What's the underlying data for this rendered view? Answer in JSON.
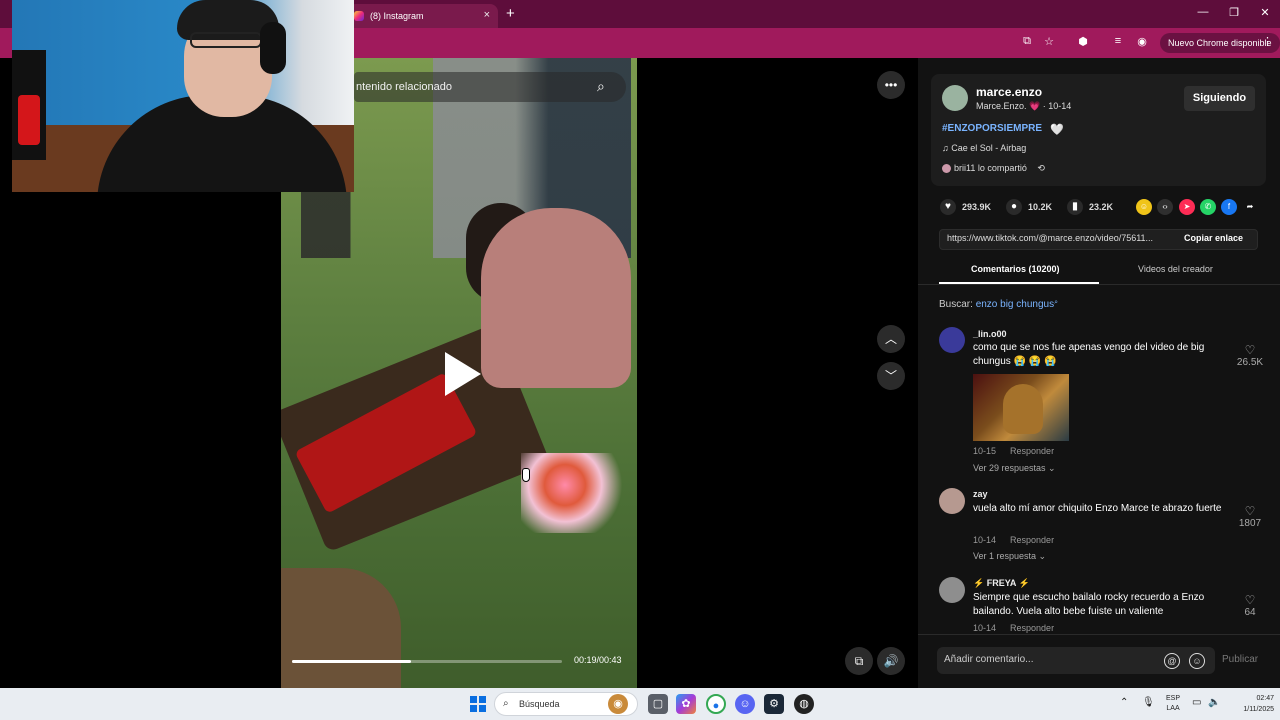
{
  "browser": {
    "tab_title": "(8) Instagram",
    "tab_close": "×",
    "new_tab": "+",
    "update_button": "Nuevo Chrome disponible",
    "window_controls": [
      "—",
      "❐",
      "✕"
    ]
  },
  "video": {
    "search_placeholder": "ntenido relacionado",
    "elapsed": "00:19",
    "duration": "00:43",
    "time_label": "00:19/00:43",
    "progress_fraction": 0.44
  },
  "post": {
    "username": "marce.enzo",
    "subtitle": "Marce.Enzo. 💗 · 10-14",
    "follow_label": "Siguiendo",
    "hashtag": "#ENZOPORSIEMPRE",
    "heart": "🤍",
    "music": "♫  Cae el Sol - Airbag",
    "shared_by": "brii11 lo compartió",
    "likes": "293.9K",
    "comments": "10.2K",
    "saves": "23.2K",
    "link": "https://www.tiktok.com/@marce.enzo/video/75611...",
    "copy_link": "Copiar enlace"
  },
  "tabs": {
    "comments": "Comentarios (10200)",
    "creator_videos": "Videos del creador"
  },
  "search_hint": {
    "prefix": "Buscar:",
    "query": "enzo big chungus"
  },
  "comments": [
    {
      "user": "_lin.o00",
      "text": "como que se nos fue apenas vengo del video de big chungus 😭 😭 😭",
      "date": "10-15",
      "reply": "Responder",
      "likes": "26.5K",
      "replies": "Ver 29 respuestas ⌄"
    },
    {
      "user": "zay",
      "text": "vuela alto mí amor chiquito Enzo Marce te abrazo fuerte",
      "date": "10-14",
      "reply": "Responder",
      "likes": "1807",
      "replies": "Ver 1 respuesta ⌄"
    },
    {
      "user": "⚡ FREYA ⚡",
      "text": "Siempre que escucho bailalo rocky recuerdo a Enzo bailando. Vuela alto bebe fuiste un valiente",
      "date": "10-14",
      "reply": "Responder",
      "likes": "64"
    }
  ],
  "composer": {
    "placeholder": "Añadir comentario...",
    "publish": "Publicar"
  },
  "taskbar": {
    "search": "Búsqueda",
    "lang_line1": "ESP",
    "lang_line2": "LAA",
    "time": "02:47",
    "date": "1/11/2025"
  },
  "colors": {
    "titlebar": "#5e0d3b",
    "toolbar": "#a01a5c",
    "panel": "#121212",
    "hashtag": "#7ab4ff"
  }
}
